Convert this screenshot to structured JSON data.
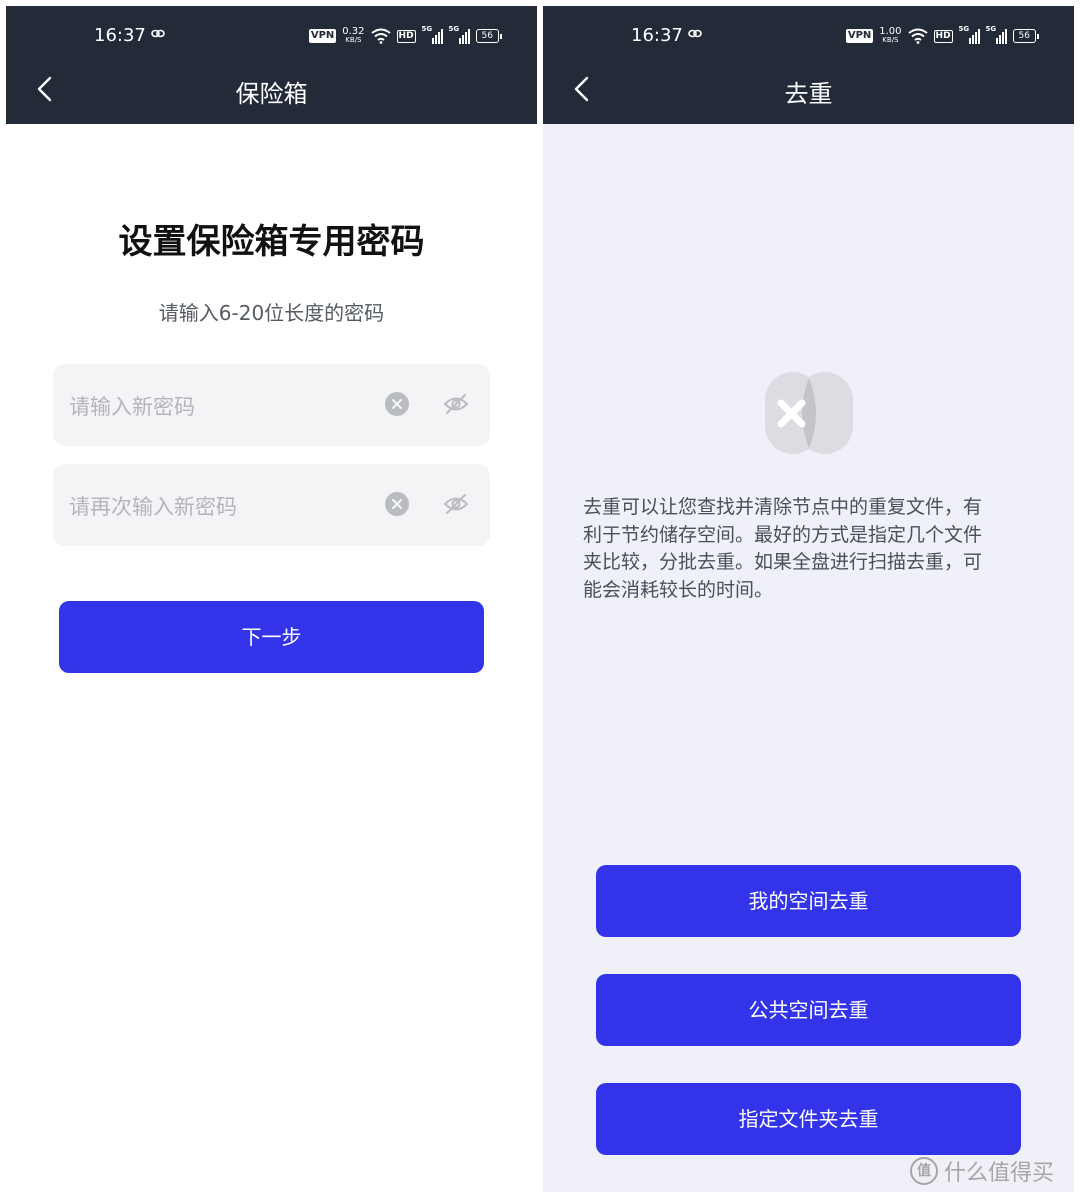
{
  "colors": {
    "header": "#232a38",
    "accent": "#3334ea",
    "right_bg": "#eff0f8"
  },
  "left": {
    "status": {
      "time": "16:37",
      "vpn": "VPN",
      "speed_value": "0.32",
      "speed_unit": "KB/S",
      "hd": "HD",
      "sig1": "5G",
      "sig2": "5G",
      "battery": "56"
    },
    "nav": {
      "back_icon": "chevron-left-icon",
      "title": "保险箱"
    },
    "heading": "设置保险箱专用密码",
    "subtitle": "请输入6-20位长度的密码",
    "fields": [
      {
        "placeholder": "请输入新密码",
        "clear_icon": "clear-icon",
        "toggle_icon": "eye-off-icon"
      },
      {
        "placeholder": "请再次输入新密码",
        "clear_icon": "clear-icon",
        "toggle_icon": "eye-off-icon"
      }
    ],
    "next_button": "下一步"
  },
  "right": {
    "status": {
      "time": "16:37",
      "vpn": "VPN",
      "speed_value": "1.00",
      "speed_unit": "KB/S",
      "hd": "HD",
      "sig1": "5G",
      "sig2": "5G",
      "battery": "56"
    },
    "nav": {
      "back_icon": "chevron-left-icon",
      "title": "去重"
    },
    "illustration_icon": "dedup-icon",
    "description_lines": [
      "去重可以让您查找并清除节点中的重复文件，有",
      "利于节约储存空间。最好的方式是指定几个文件",
      "夹比较，分批去重。如果全盘进行扫描去重，可",
      "能会消耗较长的时间。"
    ],
    "buttons": [
      "我的空间去重",
      "公共空间去重",
      "指定文件夹去重"
    ]
  },
  "watermark": {
    "logo": "值",
    "text": "什么值得买"
  }
}
